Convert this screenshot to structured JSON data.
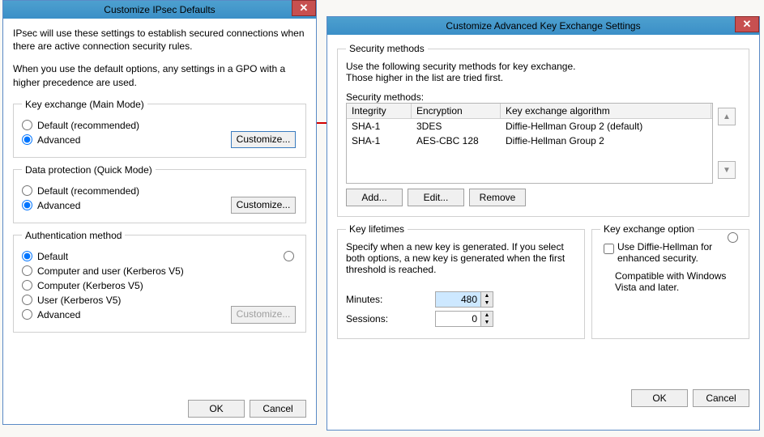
{
  "dialog1": {
    "title": "Customize IPsec Defaults",
    "desc1": "IPsec will use these settings to establish secured connections when there are active connection security rules.",
    "desc2": "When you use the default options, any settings in a GPO with a higher precedence are used.",
    "group1": {
      "legend": "Key exchange (Main Mode)",
      "opt1": "Default (recommended)",
      "opt2": "Advanced",
      "customize": "Customize..."
    },
    "group2": {
      "legend": "Data protection (Quick Mode)",
      "opt1": "Default (recommended)",
      "opt2": "Advanced",
      "customize": "Customize..."
    },
    "group3": {
      "legend": "Authentication method",
      "opt1": "Default",
      "opt2": "Computer and user (Kerberos V5)",
      "opt3": "Computer (Kerberos V5)",
      "opt4": "User (Kerberos V5)",
      "opt5": "Advanced",
      "customize": "Customize..."
    },
    "ok": "OK",
    "cancel": "Cancel"
  },
  "dialog2": {
    "title": "Customize Advanced Key Exchange Settings",
    "sm": {
      "legend": "Security methods",
      "desc1": "Use the following security methods for key exchange.",
      "desc2": "Those higher in the list are tried first.",
      "tableLabel": "Security methods:",
      "th1": "Integrity",
      "th2": "Encryption",
      "th3": "Key exchange algorithm",
      "rows": [
        {
          "c1": "SHA-1",
          "c2": "3DES",
          "c3": "Diffie-Hellman Group 2 (default)"
        },
        {
          "c1": "SHA-1",
          "c2": "AES-CBC 128",
          "c3": "Diffie-Hellman Group 2"
        }
      ],
      "add": "Add...",
      "edit": "Edit...",
      "remove": "Remove"
    },
    "kl": {
      "legend": "Key lifetimes",
      "desc": "Specify when a new key is generated. If you select both options, a new key is generated when the first threshold is reached.",
      "minutes_label": "Minutes:",
      "minutes_value": "480",
      "sessions_label": "Sessions:",
      "sessions_value": "0"
    },
    "ko": {
      "legend": "Key exchange option",
      "chk": "Use Diffie-Hellman for enhanced security.",
      "compat": "Compatible with Windows Vista and later."
    },
    "ok": "OK",
    "cancel": "Cancel"
  }
}
